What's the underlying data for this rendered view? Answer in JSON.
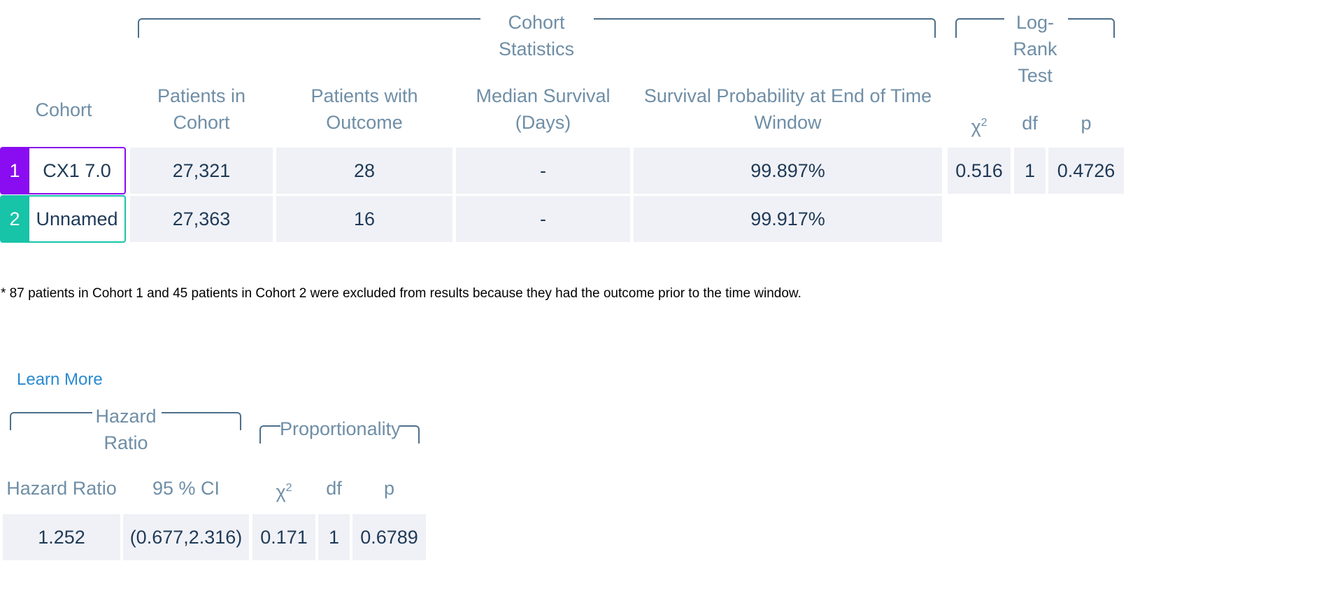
{
  "cohort_table": {
    "groups": {
      "cohort_statistics": "Cohort Statistics",
      "log_rank_test": "Log-Rank Test"
    },
    "headers": {
      "cohort": "Cohort",
      "patients_in_cohort": "Patients in Cohort",
      "patients_with_outcome": "Patients with Outcome",
      "median_survival": "Median Survival (Days)",
      "survival_probability": "Survival Probability at End of Time Window",
      "chi_symbol": "χ",
      "chi_exp": "2",
      "df": "df",
      "p": "p"
    },
    "rows": [
      {
        "number": "1",
        "name": "CX1 7.0",
        "color": "#8a0cf0",
        "patients_in_cohort": "27,321",
        "patients_with_outcome": "28",
        "median_survival": "-",
        "survival_probability": "99.897%"
      },
      {
        "number": "2",
        "name": "Unnamed",
        "color": "#17c4a8",
        "patients_in_cohort": "27,363",
        "patients_with_outcome": "16",
        "median_survival": "-",
        "survival_probability": "99.917%"
      }
    ],
    "log_rank": {
      "chi2": "0.516",
      "df": "1",
      "p": "0.4726"
    }
  },
  "footnote": "* 87 patients in Cohort 1 and 45 patients in Cohort 2 were excluded from results because they had the outcome prior to the time window.",
  "learn_more": "Learn More",
  "hazard_table": {
    "groups": {
      "hazard_ratio": "Hazard Ratio",
      "proportionality": "Proportionality"
    },
    "headers": {
      "hazard_ratio": "Hazard Ratio",
      "ci": "95 % CI",
      "chi_symbol": "χ",
      "chi_exp": "2",
      "df": "df",
      "p": "p"
    },
    "values": {
      "hazard_ratio": "1.252",
      "ci": "(0.677,2.316)",
      "chi2": "0.171",
      "df": "1",
      "p": "0.6789"
    }
  }
}
